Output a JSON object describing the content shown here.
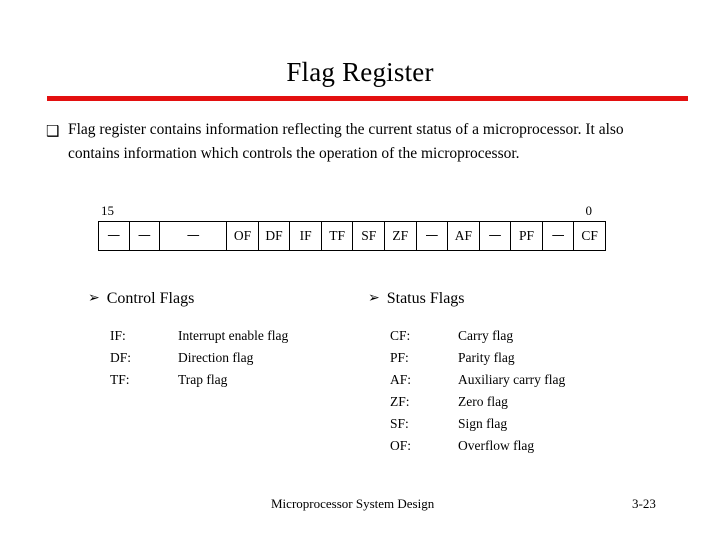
{
  "slide": {
    "title": "Flag Register",
    "accent_color": "#e31010",
    "background_color": "#ffffff",
    "text_color": "#000000"
  },
  "intro": {
    "bullet_glyph": "❑",
    "bullet_icon_name": "hollow-square-bullet-icon",
    "text": "Flag register contains information reflecting the current status of a microprocessor. It also contains information which controls the operation of the microprocessor."
  },
  "register": {
    "msb_label": "15",
    "lsb_label": "0",
    "cells": [
      {
        "label": "—",
        "width": "w-sm",
        "reserved": true
      },
      {
        "label": "—",
        "width": "w-sm",
        "reserved": true
      },
      {
        "label": "—",
        "width": "w-lg",
        "reserved": true
      },
      {
        "label": "OF",
        "width": "w-md",
        "reserved": false
      },
      {
        "label": "DF",
        "width": "w-md",
        "reserved": false
      },
      {
        "label": "IF",
        "width": "w-md",
        "reserved": false
      },
      {
        "label": "TF",
        "width": "w-md",
        "reserved": false
      },
      {
        "label": "SF",
        "width": "w-md",
        "reserved": false
      },
      {
        "label": "ZF",
        "width": "w-md",
        "reserved": false
      },
      {
        "label": "—",
        "width": "w-md",
        "reserved": true
      },
      {
        "label": "AF",
        "width": "w-md",
        "reserved": false
      },
      {
        "label": "—",
        "width": "w-md",
        "reserved": true
      },
      {
        "label": "PF",
        "width": "w-md",
        "reserved": false
      },
      {
        "label": "—",
        "width": "w-md",
        "reserved": true
      },
      {
        "label": "CF",
        "width": "w-md",
        "reserved": false
      }
    ]
  },
  "control_flags": {
    "heading": "Control Flags",
    "arrow_glyph": "➢",
    "arrow_icon_name": "arrow-bullet-icon",
    "items": [
      {
        "abbr": "IF:",
        "desc": "Interrupt enable flag"
      },
      {
        "abbr": "DF:",
        "desc": "Direction flag"
      },
      {
        "abbr": "TF:",
        "desc": "Trap flag"
      }
    ]
  },
  "status_flags": {
    "heading": "Status Flags",
    "arrow_glyph": "➢",
    "arrow_icon_name": "arrow-bullet-icon",
    "items": [
      {
        "abbr": "CF:",
        "desc": "Carry flag"
      },
      {
        "abbr": "PF:",
        "desc": "Parity flag"
      },
      {
        "abbr": "AF:",
        "desc": "Auxiliary carry flag"
      },
      {
        "abbr": "ZF:",
        "desc": "Zero flag"
      },
      {
        "abbr": "SF:",
        "desc": "Sign flag"
      },
      {
        "abbr": "OF:",
        "desc": "Overflow flag"
      }
    ]
  },
  "footer": {
    "course": "Microprocessor System Design",
    "page": "3-23"
  }
}
